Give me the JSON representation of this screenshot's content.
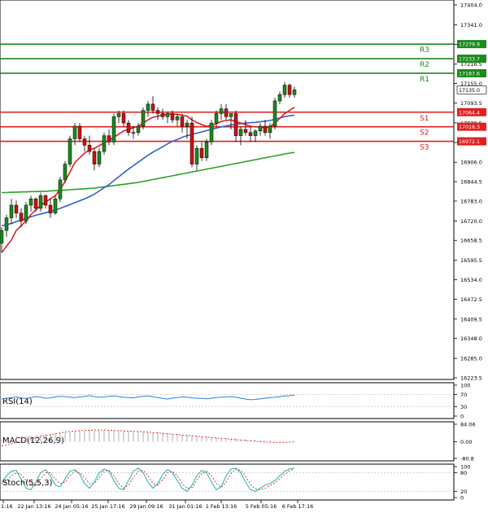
{
  "chart_data": {
    "type": "candlestick",
    "y_axis": {
      "ticks": [
        "17404.0",
        "17341.0",
        "17279.0",
        "17216.5",
        "17155.0",
        "17093.5",
        "17030.5",
        "16968.5",
        "16906.0",
        "16844.5",
        "16783.0",
        "16720.0",
        "16658.5",
        "16595.5",
        "16534.0",
        "16472.5",
        "16409.5",
        "16348.0",
        "16285.0",
        "16223.5"
      ],
      "min": 16223.5,
      "max": 17404.0
    },
    "x_axis": {
      "ticks": [
        "1:16",
        "22 Jan 13:16",
        "24 Jan 05:16",
        "25 Jan 17:16",
        "29 Jan 09:16",
        "31 Jan 01:16",
        "1 Feb 13:16",
        "5 Feb 05:16",
        "6 Feb 17:16"
      ]
    },
    "levels": [
      {
        "label": "R3",
        "price": 17279.9,
        "value_text": "17279.9",
        "color": "#1a8a1a"
      },
      {
        "label": "R2",
        "price": 17233.7,
        "value_text": "17233.7",
        "color": "#1a8a1a"
      },
      {
        "label": "R1",
        "price": 17187.6,
        "value_text": "17187.6",
        "color": "#1a8a1a"
      },
      {
        "label": "S1",
        "price": 17064.4,
        "value_text": "17064.4",
        "color": "#e02020"
      },
      {
        "label": "S2",
        "price": 17018.3,
        "value_text": "17018.3",
        "color": "#e02020"
      },
      {
        "label": "S3",
        "price": 16972.1,
        "value_text": "16972.1",
        "color": "#e02020"
      }
    ],
    "current_price": {
      "value": 17135.0,
      "text": "17135.0"
    },
    "candles": [
      [
        16650,
        16700,
        16620,
        16690
      ],
      [
        16690,
        16740,
        16670,
        16730
      ],
      [
        16730,
        16790,
        16710,
        16770
      ],
      [
        16770,
        16785,
        16730,
        16745
      ],
      [
        16745,
        16760,
        16700,
        16720
      ],
      [
        16720,
        16780,
        16710,
        16770
      ],
      [
        16770,
        16800,
        16750,
        16790
      ],
      [
        16790,
        16795,
        16750,
        16760
      ],
      [
        16760,
        16810,
        16750,
        16800
      ],
      [
        16800,
        16805,
        16760,
        16770
      ],
      [
        16770,
        16790,
        16730,
        16745
      ],
      [
        16745,
        16800,
        16740,
        16790
      ],
      [
        16790,
        16860,
        16780,
        16850
      ],
      [
        16850,
        16910,
        16840,
        16900
      ],
      [
        16900,
        16990,
        16890,
        16980
      ],
      [
        16980,
        17030,
        16960,
        17020
      ],
      [
        17020,
        17030,
        16970,
        16980
      ],
      [
        16980,
        16990,
        16940,
        16960
      ],
      [
        16960,
        16990,
        16930,
        16940
      ],
      [
        16940,
        16950,
        16880,
        16900
      ],
      [
        16900,
        16950,
        16890,
        16940
      ],
      [
        16940,
        17000,
        16930,
        16990
      ],
      [
        16990,
        17010,
        16960,
        16970
      ],
      [
        16970,
        17060,
        16960,
        17050
      ],
      [
        17050,
        17070,
        17030,
        17060
      ],
      [
        17060,
        17070,
        17020,
        17030
      ],
      [
        17030,
        17040,
        16990,
        17000
      ],
      [
        17000,
        17020,
        16980,
        17000
      ],
      [
        17000,
        17030,
        16990,
        17020
      ],
      [
        17020,
        17080,
        17010,
        17070
      ],
      [
        17070,
        17100,
        17050,
        17090
      ],
      [
        17090,
        17115,
        17060,
        17070
      ],
      [
        17070,
        17080,
        17040,
        17060
      ],
      [
        17060,
        17075,
        17040,
        17050
      ],
      [
        17050,
        17065,
        17030,
        17060
      ],
      [
        17060,
        17070,
        17030,
        17040
      ],
      [
        17040,
        17060,
        17020,
        17050
      ],
      [
        17050,
        17060,
        17000,
        17020
      ],
      [
        17020,
        17040,
        16980,
        17030
      ],
      [
        17030,
        17050,
        16890,
        16900
      ],
      [
        16900,
        16960,
        16880,
        16950
      ],
      [
        16950,
        16970,
        16910,
        16920
      ],
      [
        16920,
        16980,
        16910,
        16970
      ],
      [
        16970,
        17040,
        16960,
        17030
      ],
      [
        17030,
        17070,
        17020,
        17060
      ],
      [
        17060,
        17090,
        17040,
        17075
      ],
      [
        17075,
        17090,
        17040,
        17050
      ],
      [
        17050,
        17060,
        17010,
        17060
      ],
      [
        17060,
        17070,
        16970,
        16990
      ],
      [
        16990,
        17020,
        16960,
        17010
      ],
      [
        17010,
        17040,
        16990,
        17000
      ],
      [
        17000,
        17020,
        16970,
        16990
      ],
      [
        16990,
        17010,
        16970,
        17005
      ],
      [
        17005,
        17030,
        16990,
        17020
      ],
      [
        17020,
        17040,
        16990,
        17000
      ],
      [
        17000,
        17030,
        16980,
        17020
      ],
      [
        17020,
        17110,
        17010,
        17100
      ],
      [
        17100,
        17130,
        17090,
        17120
      ],
      [
        17120,
        17160,
        17110,
        17150
      ],
      [
        17150,
        17155,
        17110,
        17120
      ],
      [
        17120,
        17145,
        17110,
        17135
      ]
    ],
    "ema_red": [
      16620,
      16640,
      16660,
      16690,
      16705,
      16720,
      16740,
      16755,
      16770,
      16780,
      16790,
      16800,
      16820,
      16845,
      16875,
      16905,
      16920,
      16935,
      16945,
      16950,
      16958,
      16968,
      16975,
      16985,
      16995,
      17005,
      17010,
      17015,
      17020,
      17030,
      17040,
      17048,
      17052,
      17055,
      17058,
      17058,
      17057,
      17055,
      17052,
      17040,
      17032,
      17025,
      17020,
      17022,
      17028,
      17035,
      17038,
      17040,
      17035,
      17030,
      17025,
      17020,
      17018,
      17018,
      17015,
      17018,
      17030,
      17045,
      17060,
      17070,
      17080
    ],
    "ema_blue": [
      16705,
      16708,
      16712,
      16718,
      16722,
      16728,
      16733,
      16738,
      16742,
      16746,
      16750,
      16755,
      16760,
      16766,
      16772,
      16778,
      16784,
      16790,
      16797,
      16805,
      16815,
      16825,
      16835,
      16848,
      16860,
      16872,
      16884,
      16895,
      16906,
      16917,
      16928,
      16938,
      16946,
      16955,
      16964,
      16972,
      16978,
      16985,
      16990,
      16994,
      16998,
      17002,
      17006,
      17010,
      17014,
      17018,
      17021,
      17024,
      17026,
      17028,
      17030,
      17031,
      17032,
      17034,
      17036,
      17038,
      17042,
      17046,
      17050,
      17053,
      17055
    ],
    "ema_green": [
      16810,
      16810,
      16811,
      16811,
      16812,
      16812,
      16813,
      16813,
      16814,
      16814,
      16815,
      16816,
      16817,
      16818,
      16819,
      16820,
      16821,
      16822,
      16823,
      16824,
      16826,
      16828,
      16830,
      16832,
      16834,
      16836,
      16838,
      16840,
      16842,
      16845,
      16848,
      16851,
      16854,
      16857,
      16860,
      16863,
      16866,
      16869,
      16872,
      16875,
      16878,
      16881,
      16884,
      16887,
      16890,
      16893,
      16896,
      16899,
      16902,
      16905,
      16908,
      16911,
      16914,
      16917,
      16920,
      16923,
      16926,
      16929,
      16932,
      16935,
      16937
    ]
  },
  "indicators": {
    "rsi": {
      "label": "RSI(14)",
      "ticks": [
        "100",
        "70",
        "30",
        "0"
      ],
      "values": [
        55,
        58,
        60,
        62,
        59,
        57,
        60,
        63,
        61,
        58,
        59,
        62,
        64,
        63,
        61,
        60,
        62,
        64,
        66,
        63,
        61,
        62,
        64,
        65,
        63,
        61,
        60,
        59,
        62,
        64,
        65,
        63,
        60,
        57,
        55,
        58,
        60,
        62,
        61,
        59,
        58,
        57,
        56,
        58,
        60,
        61,
        62,
        63,
        61,
        58,
        55,
        53,
        54,
        56,
        58,
        60,
        61,
        63,
        65,
        66,
        67
      ]
    },
    "macd": {
      "label": "MACD(12,26,9)",
      "ticks": [
        "84.06",
        "0.00",
        "-80.8"
      ],
      "hist": [
        10,
        14,
        18,
        22,
        26,
        28,
        30,
        32,
        34,
        36,
        38,
        40,
        42,
        44,
        46,
        48,
        50,
        52,
        54,
        55,
        56,
        56,
        55,
        54,
        53,
        52,
        51,
        50,
        49,
        48,
        47,
        46,
        45,
        43,
        41,
        39,
        37,
        35,
        33,
        31,
        29,
        27,
        25,
        23,
        21,
        19,
        17,
        15,
        13,
        11,
        10,
        9,
        8,
        7,
        6,
        5,
        4,
        3,
        2,
        2,
        2
      ],
      "signal": [
        -20,
        -16,
        -10,
        -4,
        2,
        8,
        14,
        20,
        25,
        30,
        34,
        38,
        42,
        46,
        49,
        51,
        53,
        54,
        55,
        56,
        56,
        56,
        55,
        54,
        53,
        52,
        51,
        50,
        49,
        48,
        46,
        44,
        42,
        40,
        38,
        36,
        34,
        32,
        30,
        28,
        26,
        24,
        22,
        20,
        18,
        16,
        14,
        12,
        10,
        8,
        6,
        4,
        2,
        0,
        -2,
        -3,
        -4,
        -4,
        -3,
        -2,
        -1
      ]
    },
    "stoch": {
      "label": "Stoch(5,5,3)",
      "ticks": [
        "100",
        "80",
        "20",
        "0"
      ],
      "k": [
        50,
        70,
        85,
        88,
        60,
        30,
        25,
        50,
        80,
        90,
        70,
        40,
        35,
        60,
        85,
        90,
        75,
        45,
        30,
        50,
        80,
        92,
        85,
        55,
        30,
        25,
        55,
        85,
        95,
        80,
        50,
        30,
        45,
        75,
        90,
        80,
        55,
        30,
        20,
        40,
        70,
        88,
        80,
        50,
        25,
        35,
        70,
        92,
        95,
        80,
        50,
        25,
        20,
        30,
        40,
        45,
        55,
        70,
        85,
        92,
        95
      ],
      "d": [
        45,
        55,
        70,
        80,
        75,
        55,
        40,
        40,
        60,
        80,
        80,
        60,
        45,
        50,
        70,
        85,
        80,
        65,
        45,
        45,
        65,
        85,
        88,
        70,
        45,
        30,
        40,
        65,
        85,
        88,
        70,
        45,
        40,
        58,
        80,
        85,
        70,
        45,
        30,
        32,
        55,
        78,
        85,
        70,
        45,
        33,
        50,
        78,
        92,
        88,
        68,
        42,
        28,
        25,
        30,
        38,
        48,
        60,
        75,
        86,
        92
      ]
    }
  }
}
